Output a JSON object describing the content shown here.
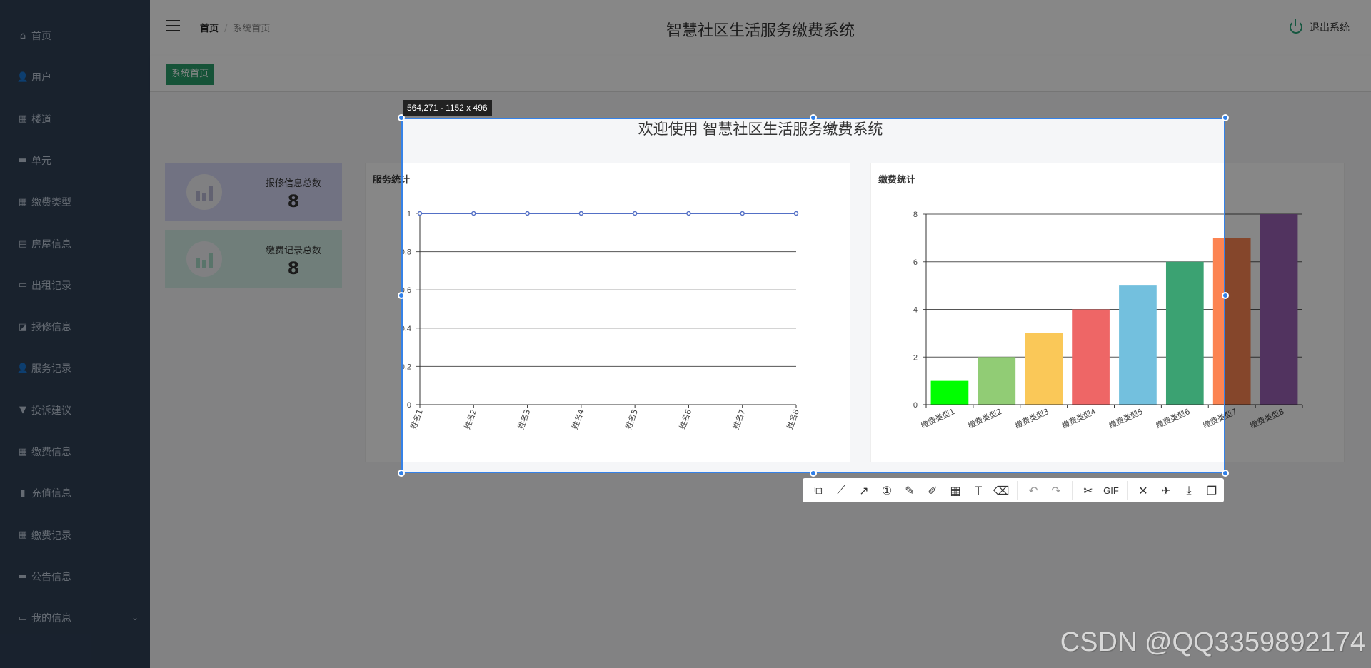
{
  "sidebar": {
    "items": [
      {
        "label": "首页",
        "icon": "home-icon"
      },
      {
        "label": "用户",
        "icon": "user-icon"
      },
      {
        "label": "楼道",
        "icon": "grid-icon"
      },
      {
        "label": "单元",
        "icon": "briefcase-icon"
      },
      {
        "label": "缴费类型",
        "icon": "grid-icon"
      },
      {
        "label": "房屋信息",
        "icon": "clipboard-icon"
      },
      {
        "label": "出租记录",
        "icon": "monitor-icon"
      },
      {
        "label": "报修信息",
        "icon": "chart-area-icon"
      },
      {
        "label": "服务记录",
        "icon": "user-icon"
      },
      {
        "label": "投诉建议",
        "icon": "pin-icon"
      },
      {
        "label": "缴费信息",
        "icon": "grid-icon"
      },
      {
        "label": "充值信息",
        "icon": "bar-chart-icon"
      },
      {
        "label": "缴费记录",
        "icon": "grid-icon"
      },
      {
        "label": "公告信息",
        "icon": "ticket-icon"
      },
      {
        "label": "我的信息",
        "icon": "card-icon",
        "expandable": true
      }
    ]
  },
  "header": {
    "breadcrumb": [
      "首页",
      "系统首页"
    ],
    "title": "智慧社区生活服务缴费系统",
    "logout_label": "退出系统"
  },
  "tabs": [
    {
      "label": "系统首页",
      "active": true
    }
  ],
  "main": {
    "welcome": "欢迎使用 智慧社区生活服务缴费系统",
    "stats": [
      {
        "label": "报修信息总数",
        "value": "8",
        "color": "#d6d7f5"
      },
      {
        "label": "缴费记录总数",
        "value": "8",
        "color": "#d3efe6"
      }
    ]
  },
  "chart_data": [
    {
      "type": "line",
      "title": "服务统计",
      "categories": [
        "姓名1",
        "姓名2",
        "姓名3",
        "姓名4",
        "姓名5",
        "姓名6",
        "姓名7",
        "姓名8"
      ],
      "values": [
        1,
        1,
        1,
        1,
        1,
        1,
        1,
        1
      ],
      "ylim": [
        0,
        1
      ],
      "yticks": [
        "0",
        "0.2",
        "0.4",
        "0.6",
        "0.8",
        "1"
      ],
      "grid": true,
      "color": "#5470c6"
    },
    {
      "type": "bar",
      "title": "缴费统计",
      "categories": [
        "缴费类型1",
        "缴费类型2",
        "缴费类型3",
        "缴费类型4",
        "缴费类型5",
        "缴费类型6",
        "缴费类型7",
        "缴费类型8"
      ],
      "values": [
        1,
        2,
        3,
        4,
        5,
        6,
        7,
        8
      ],
      "ylim": [
        0,
        8
      ],
      "yticks": [
        "0",
        "2",
        "4",
        "6",
        "8"
      ],
      "grid": true,
      "colors": [
        "#00ff00",
        "#91cc75",
        "#fac858",
        "#ee6666",
        "#73c0de",
        "#3ba272",
        "#fc8452",
        "#9a60b4"
      ]
    }
  ],
  "capture": {
    "dimension_label": "564,271 - 1152 x 496",
    "tools": [
      {
        "name": "shape-tool",
        "glyph": "⧉"
      },
      {
        "name": "polyline-tool",
        "glyph": "⟋"
      },
      {
        "name": "arrow-tool",
        "glyph": "↗"
      },
      {
        "name": "number-marker-tool",
        "glyph": "①"
      },
      {
        "name": "pencil-tool",
        "glyph": "✎"
      },
      {
        "name": "highlighter-tool",
        "glyph": "✐"
      },
      {
        "name": "mosaic-tool",
        "glyph": "▦"
      },
      {
        "name": "text-tool",
        "glyph": "T"
      },
      {
        "name": "eraser-tool",
        "glyph": "⌫"
      }
    ],
    "history": [
      {
        "name": "undo-button",
        "glyph": "↶"
      },
      {
        "name": "redo-button",
        "glyph": "↷"
      }
    ],
    "record": [
      {
        "name": "screen-record-button",
        "glyph": "✂"
      },
      {
        "name": "gif-button",
        "glyph": "GIF"
      }
    ],
    "actions": [
      {
        "name": "cancel-button",
        "glyph": "✕"
      },
      {
        "name": "pin-button",
        "glyph": "✈"
      },
      {
        "name": "download-button",
        "glyph": "⤓"
      },
      {
        "name": "copy-button",
        "glyph": "❐"
      }
    ]
  },
  "watermark": "CSDN @QQ3359892174"
}
